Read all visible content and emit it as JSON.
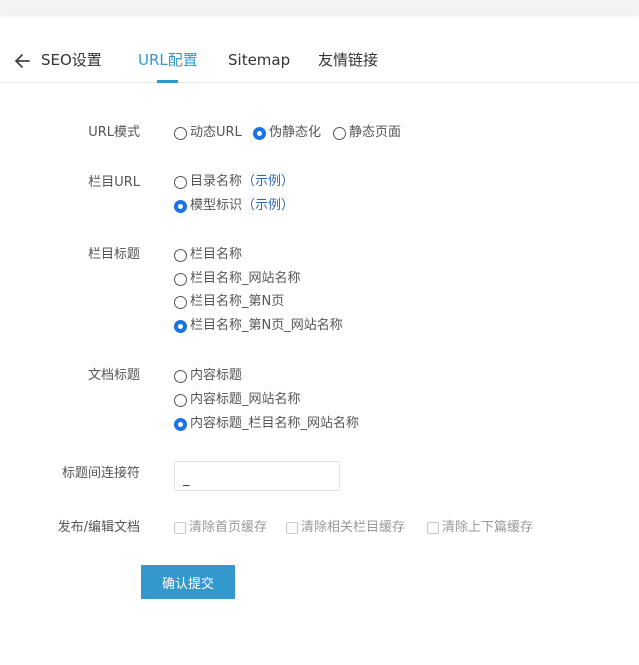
{
  "header": {
    "back_icon": "arrow-left-icon",
    "title": "SEO设置",
    "tabs": [
      {
        "label": "URL配置",
        "active": true
      },
      {
        "label": "Sitemap",
        "active": false
      },
      {
        "label": "友情链接",
        "active": false
      }
    ],
    "accent_color": "#3399cc"
  },
  "form": {
    "url_mode": {
      "label": "URL模式",
      "options": [
        {
          "label": "动态URL",
          "checked": false
        },
        {
          "label": "伪静态化",
          "checked": true
        },
        {
          "label": "静态页面",
          "checked": false
        }
      ]
    },
    "column_url": {
      "label": "栏目URL",
      "options": [
        {
          "label": "目录名称",
          "example": "（示例）",
          "checked": false
        },
        {
          "label": "模型标识",
          "example": "（示例）",
          "checked": true
        }
      ]
    },
    "column_title": {
      "label": "栏目标题",
      "options": [
        {
          "label": "栏目名称",
          "checked": false
        },
        {
          "label": "栏目名称_网站名称",
          "checked": false
        },
        {
          "label": "栏目名称_第N页",
          "checked": false
        },
        {
          "label": "栏目名称_第N页_网站名称",
          "checked": true
        }
      ]
    },
    "doc_title": {
      "label": "文档标题",
      "options": [
        {
          "label": "内容标题",
          "checked": false
        },
        {
          "label": "内容标题_网站名称",
          "checked": false
        },
        {
          "label": "内容标题_栏目名称_网站名称",
          "checked": true
        }
      ]
    },
    "separator": {
      "label": "标题间连接符",
      "value": "_"
    },
    "publish": {
      "label": "发布/编辑文档",
      "options": [
        {
          "label": "清除首页缓存",
          "checked": false
        },
        {
          "label": "清除相关栏目缓存",
          "checked": false
        },
        {
          "label": "清除上下篇缓存",
          "checked": false
        }
      ]
    },
    "submit_label": "确认提交",
    "radio_color": "#1a73e8"
  }
}
